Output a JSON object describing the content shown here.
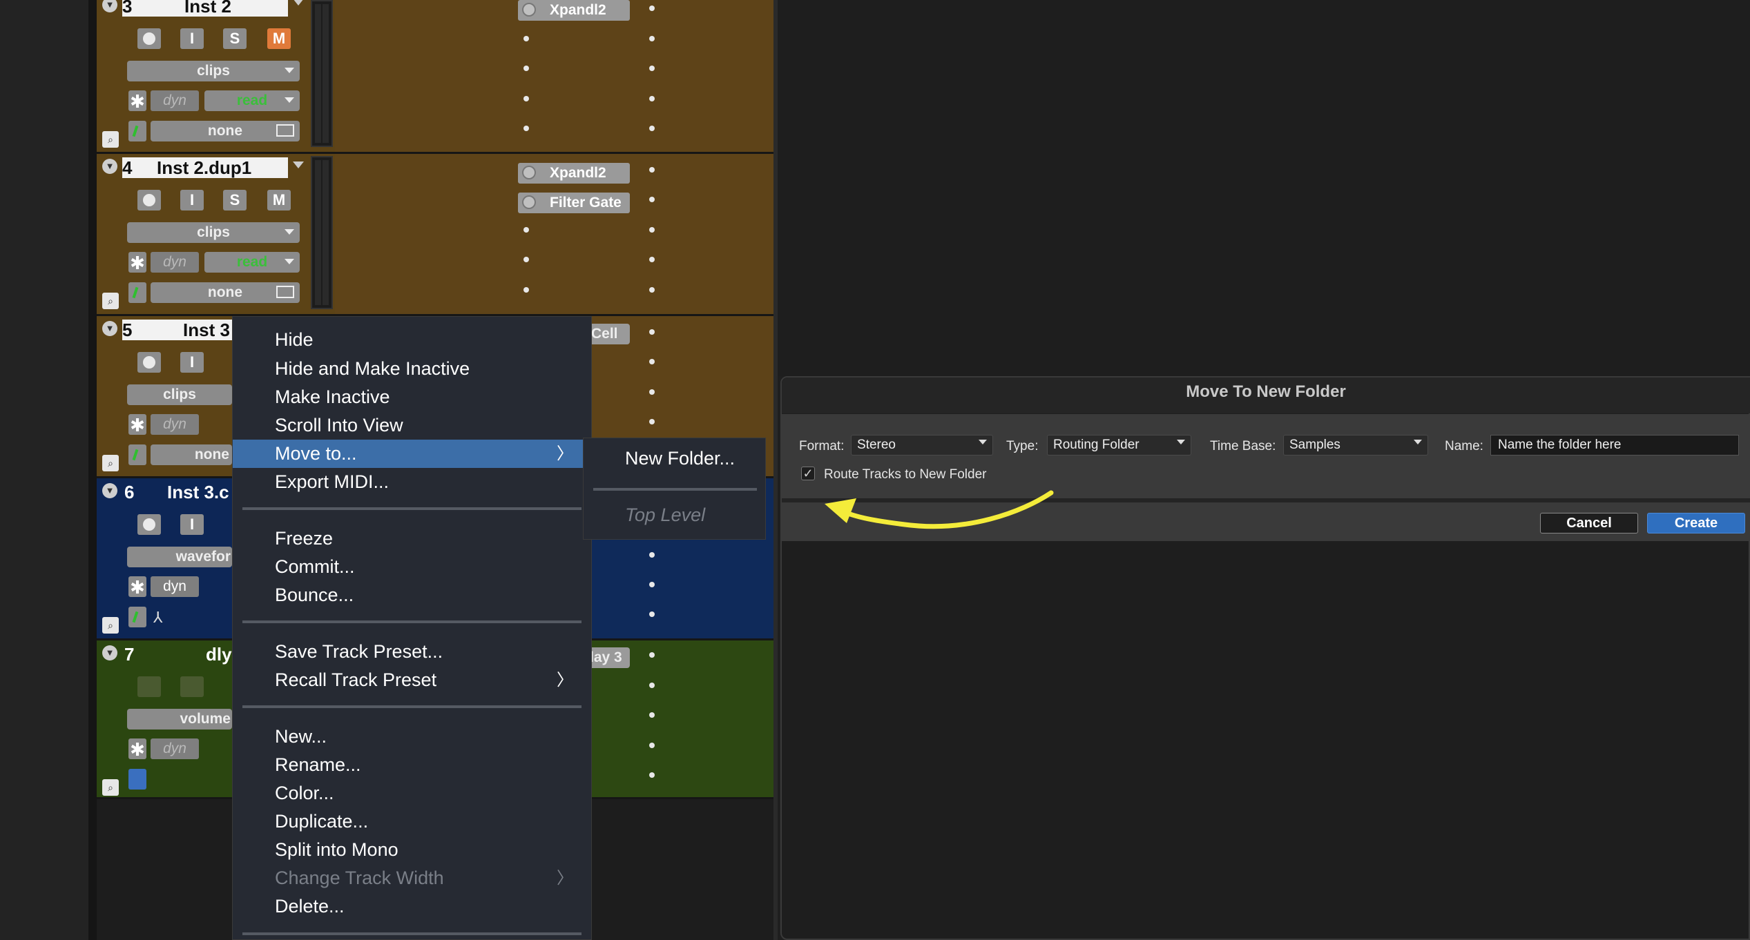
{
  "tracks": [
    {
      "num": "3",
      "name": "Inst 2",
      "mute": "M",
      "rec": "",
      "input": "I",
      "solo": "S",
      "view": "clips",
      "dyn": "dyn",
      "auto": "read",
      "group": "none",
      "plugins": [
        "Xpandl2"
      ]
    },
    {
      "num": "4",
      "name": "Inst 2.dup1",
      "mute": "M",
      "rec": "",
      "input": "I",
      "solo": "S",
      "view": "clips",
      "dyn": "dyn",
      "auto": "read",
      "group": "none",
      "plugins": [
        "Xpandl2",
        "Filter Gate"
      ]
    },
    {
      "num": "5",
      "name": "Inst 3",
      "input": "I",
      "view": "clips",
      "dyn": "dyn",
      "group": "none",
      "plugins": [
        "Cell"
      ]
    },
    {
      "num": "6",
      "name": "Inst 3.c",
      "input": "I",
      "view": "wavefor",
      "dyn": "dyn"
    },
    {
      "num": "7",
      "name": "dly",
      "view": "volume",
      "dyn": "dyn",
      "plugins": [
        "lay 3"
      ]
    }
  ],
  "context_menu": {
    "items": [
      "Hide",
      "Hide and Make Inactive",
      "Make Inactive",
      "Scroll Into View",
      "Move to...",
      "Export MIDI...",
      "Freeze",
      "Commit...",
      "Bounce...",
      "Save Track Preset...",
      "Recall Track Preset",
      "New...",
      "Rename...",
      "Color...",
      "Duplicate...",
      "Split into Mono",
      "Change Track Width",
      "Delete..."
    ],
    "submenu": {
      "new_folder": "New Folder...",
      "top_level": "Top Level"
    }
  },
  "dialog": {
    "title": "Move To New Folder",
    "format_label": "Format:",
    "format_value": "Stereo",
    "type_label": "Type:",
    "type_value": "Routing Folder",
    "timebase_label": "Time Base:",
    "timebase_value": "Samples",
    "name_label": "Name:",
    "name_value": "Name the folder here",
    "route_label": "Route Tracks to New Folder",
    "route_checked": "✓",
    "cancel": "Cancel",
    "create": "Create"
  },
  "colors": {
    "brown": "#5e4318",
    "blue": "#0f2a5a",
    "green": "#2d4812",
    "accent": "#2f6fbf",
    "arrow": "#f4ec3a"
  }
}
